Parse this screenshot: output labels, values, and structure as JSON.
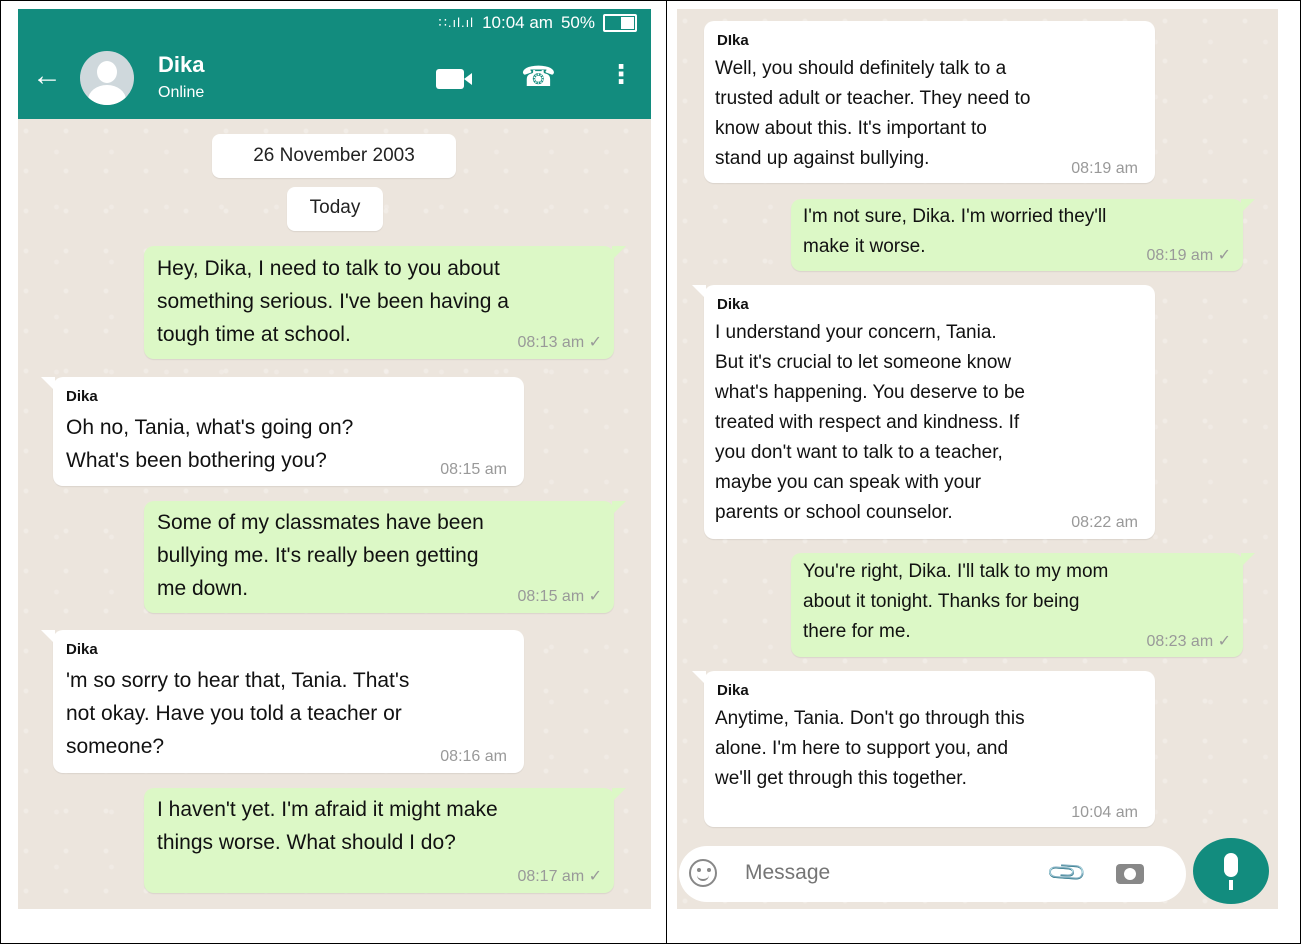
{
  "status_bar": {
    "signal": "∷.ıl.ıl",
    "time": "10:04 am",
    "battery": "50%"
  },
  "contact": {
    "name": "Dika",
    "status": "Online"
  },
  "icons": {
    "back": "←",
    "call": "☎",
    "menu": "⋮",
    "attach": "📎"
  },
  "dates": {
    "first": "26 November 2003",
    "today": "Today"
  },
  "left_messages": [
    {
      "direction": "out",
      "text": "Hey, Dika, I need to talk to you about\nsomething serious. I've been having a\ntough time at school.",
      "time": "08:13 am ✓"
    },
    {
      "direction": "in",
      "sender": "Dika",
      "text": "Oh no, Tania, what's going on?\nWhat's been bothering you?",
      "time": "08:15 am"
    },
    {
      "direction": "out",
      "text": "Some of my classmates have been\nbullying me. It's really been getting\nme down.",
      "time": "08:15 am ✓"
    },
    {
      "direction": "in",
      "sender": "Dika",
      "text": "'m so sorry to hear that, Tania. That's\nnot okay. Have you told a teacher or\nsomeone?",
      "time": "08:16 am"
    },
    {
      "direction": "out",
      "text": "I haven't yet. I'm afraid it might make\nthings worse. What should I do?",
      "time": "08:17 am ✓"
    }
  ],
  "right_messages": [
    {
      "direction": "in",
      "sender": "DIka",
      "text": "Well, you should definitely talk to a\ntrusted adult or teacher. They need to\nknow about this. It's important to\nstand up against bullying.",
      "time": "08:19 am"
    },
    {
      "direction": "out",
      "text": "I'm not sure, Dika. I'm worried they'll\nmake it worse.",
      "time": "08:19 am ✓"
    },
    {
      "direction": "in",
      "sender": "Dika",
      "text": "I understand your concern, Tania.\nBut it's crucial to let someone know\nwhat's happening. You deserve to be\ntreated with respect and kindness. If\nyou don't want to talk to a teacher,\nmaybe you can speak with your\nparents or school counselor.",
      "time": "08:22 am"
    },
    {
      "direction": "out",
      "text": "You're right, Dika. I'll talk to my mom\nabout it tonight. Thanks for being\nthere for me.",
      "time": "08:23 am ✓"
    },
    {
      "direction": "in",
      "sender": "Dika",
      "text": "Anytime, Tania. Don't go through this\nalone. I'm here to support you, and\nwe'll get through this together.",
      "time": "10:04 am"
    }
  ],
  "composer": {
    "placeholder": "Message"
  },
  "colors": {
    "header": "#128c7e",
    "outgoing_bubble": "#dcf8c6",
    "incoming_bubble": "#ffffff",
    "chat_background": "#ece5dd"
  }
}
